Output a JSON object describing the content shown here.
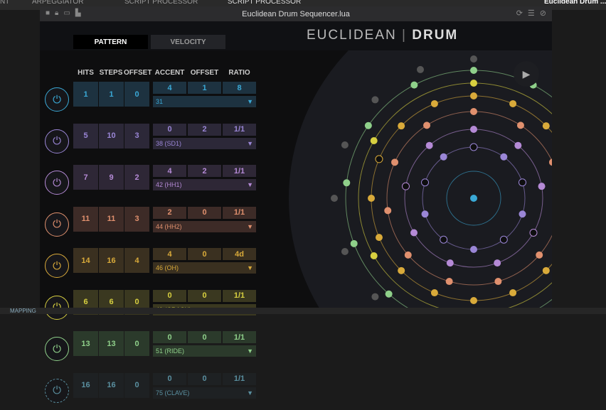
{
  "tabs": [
    {
      "label": "NT"
    },
    {
      "label": "ARPEGGIATOR"
    },
    {
      "label": "SCRIPT PROCESSOR"
    },
    {
      "label": "SCRIPT PROCESSOR"
    }
  ],
  "top_right": "Euclidean Drum ...",
  "window_title": "Euclidean Drum Sequencer.lua",
  "pattern_tab": "PATTERN",
  "velocity_tab": "VELOCITY",
  "logo": {
    "a": "EUCLIDEAN",
    "sep": "|",
    "b": "DRUM"
  },
  "headers": {
    "hits": "HITS",
    "steps": "STEPS",
    "offset": "OFFSET",
    "accent": "ACCENT",
    "offset2": "OFFSET",
    "ratio": "RATIO"
  },
  "rows": [
    {
      "hits": "1",
      "steps": "1",
      "offset": "0",
      "accent": "4",
      "aoffset": "1",
      "ratio": "8",
      "note": "31",
      "color": "#3aa9d6",
      "bg": "#1d3240"
    },
    {
      "hits": "5",
      "steps": "10",
      "offset": "3",
      "accent": "0",
      "aoffset": "2",
      "ratio": "1/1",
      "note": "38 (SD1)",
      "color": "#9a86d6",
      "bg": "#2c2838"
    },
    {
      "hits": "7",
      "steps": "9",
      "offset": "2",
      "accent": "4",
      "aoffset": "2",
      "ratio": "1/1",
      "note": "42 (HH1)",
      "color": "#b58ad6",
      "bg": "#2e2736"
    },
    {
      "hits": "11",
      "steps": "11",
      "offset": "3",
      "accent": "2",
      "aoffset": "0",
      "ratio": "1/1",
      "note": "44 (HH2)",
      "color": "#e0906e",
      "bg": "#3d2b27"
    },
    {
      "hits": "14",
      "steps": "16",
      "offset": "4",
      "accent": "4",
      "aoffset": "0",
      "ratio": "4d",
      "note": "46 (OH)",
      "color": "#d9aa3a",
      "bg": "#3a3020"
    },
    {
      "hits": "6",
      "steps": "6",
      "offset": "0",
      "accent": "0",
      "aoffset": "0",
      "ratio": "1/1",
      "note": "49 (CRASH)",
      "color": "#d8d040",
      "bg": "#3a3820"
    },
    {
      "hits": "13",
      "steps": "13",
      "offset": "0",
      "accent": "0",
      "aoffset": "0",
      "ratio": "1/1",
      "note": "51 (RIDE)",
      "color": "#8fd08a",
      "bg": "#2b3a2b"
    },
    {
      "hits": "16",
      "steps": "16",
      "offset": "0",
      "accent": "0",
      "aoffset": "0",
      "ratio": "1/1",
      "note": "75 (CLAVE)",
      "color": "#6fb6cc",
      "bg": "#1f2326"
    }
  ],
  "bottom": "MAPPING"
}
